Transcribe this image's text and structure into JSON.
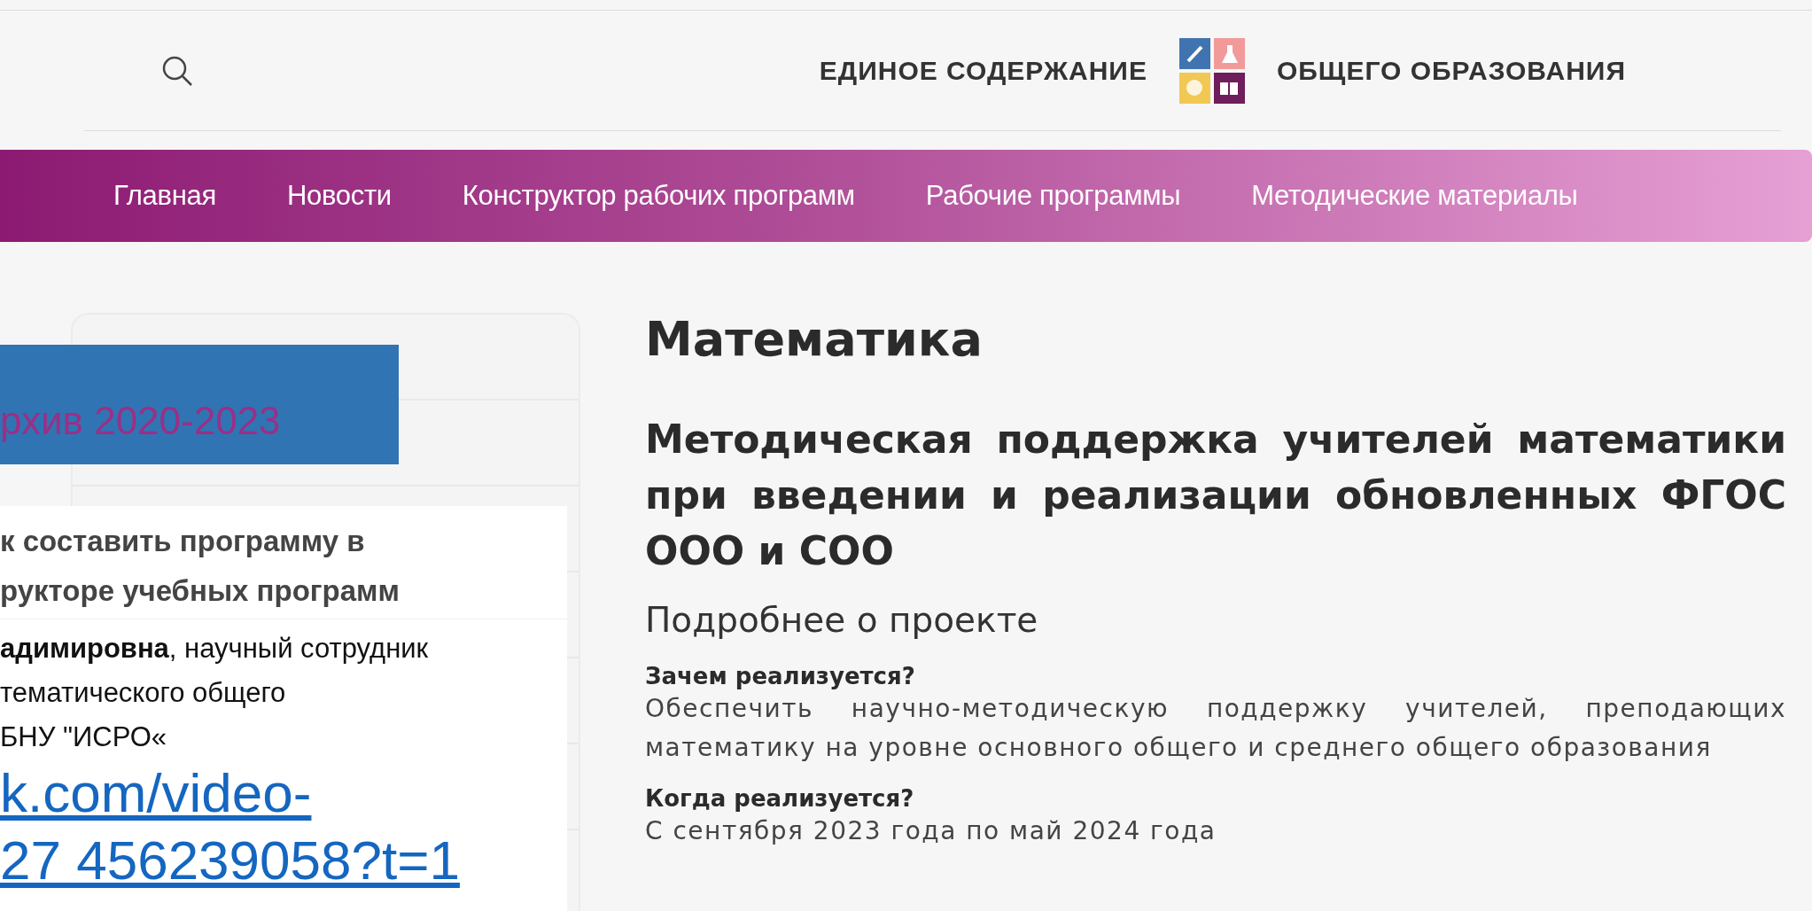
{
  "header": {
    "title_left": "ЕДИНОЕ СОДЕРЖАНИЕ",
    "title_right": "ОБЩЕГО ОБРАЗОВАНИЯ"
  },
  "nav": [
    "Главная",
    "Новости",
    "Конструктор рабочих программ",
    "Рабочие программы",
    "Методические материалы"
  ],
  "content": {
    "title": "Математика",
    "subtitle": "Методическая поддержка учителей математики при введении и реализации обновленных ФГОС ООО и СОО",
    "section": "Подробнее о проекте",
    "blocks": [
      {
        "heading": "Зачем реализуется?",
        "text": "Обеспечить научно-методическую поддержку учителей, преподающих математику на уровне основного общего и среднего общего образования"
      },
      {
        "heading": "Когда реализуется?",
        "text": "С сентября 2023 года по май 2024 года"
      }
    ]
  },
  "archive_label": "рхив 2020-2023",
  "slide": {
    "title_lines": [
      "к составить программу в",
      "рукторе учебных программ"
    ],
    "body_lines": [
      "**адимировна**, научный сотрудник",
      "тематического общего",
      "БНУ \"ИСРО«"
    ],
    "link_lines": [
      "k.com/video-",
      "27 456239058?t=1"
    ]
  }
}
